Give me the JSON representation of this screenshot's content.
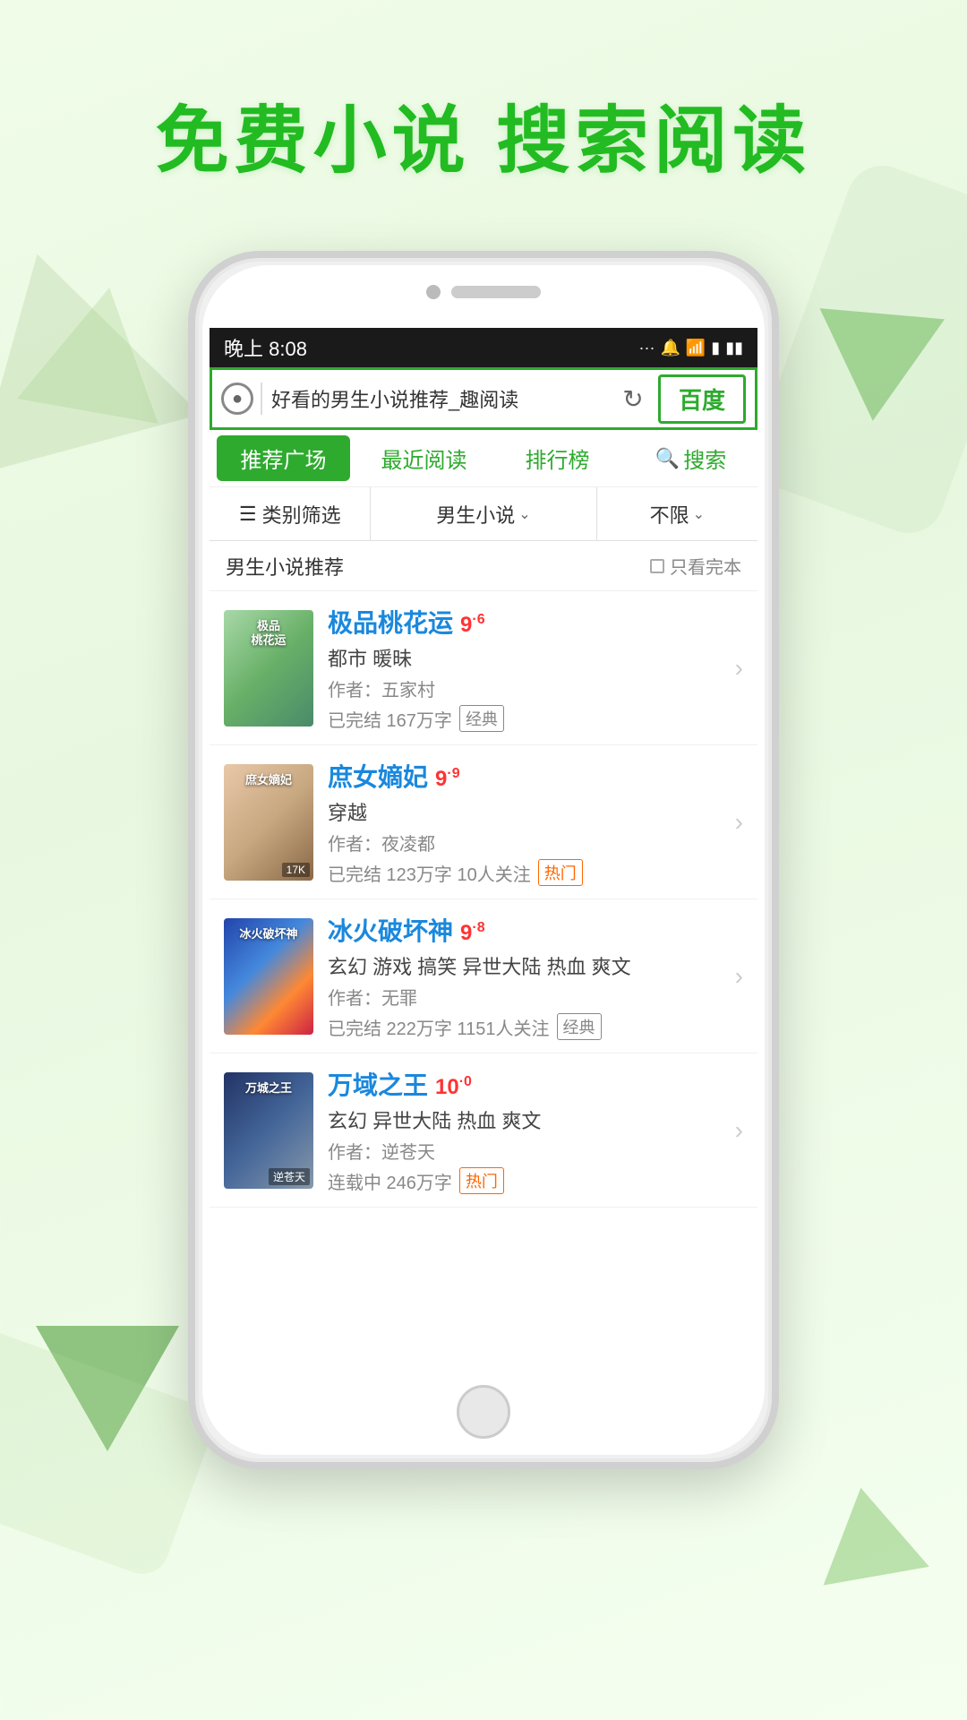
{
  "page": {
    "background_color": "#eefae6",
    "header_title": "免费小说  搜索阅读"
  },
  "status_bar": {
    "time": "晚上 8:08",
    "icons": "... 🔔 WiFi 📷 ⚡ 🔋"
  },
  "search_bar": {
    "query": "好看的男生小说推荐_趣阅读",
    "baidu_label": "百度"
  },
  "tabs": [
    {
      "id": "recommend",
      "label": "推荐广场",
      "active": true
    },
    {
      "id": "recent",
      "label": "最近阅读",
      "active": false
    },
    {
      "id": "ranking",
      "label": "排行榜",
      "active": false
    },
    {
      "id": "search",
      "label": "搜索",
      "active": false
    }
  ],
  "filters": {
    "category_label": "类别筛选",
    "gender_label": "男生小说",
    "limit_label": "不限"
  },
  "section": {
    "title": "男生小说推荐",
    "filter_label": "只看完本"
  },
  "books": [
    {
      "id": "1",
      "title": "极品桃花运",
      "rating": "9",
      "rating_decimal": "6",
      "genre": "都市 暖昧",
      "author": "作者：五家村",
      "meta": "已完结 167万字",
      "tag": "经典",
      "tag_type": "classic",
      "cover_text": "极品\n桃花运",
      "cover_type": "1"
    },
    {
      "id": "2",
      "title": "庶女嫡妃",
      "rating": "9",
      "rating_decimal": "9",
      "genre": "穿越",
      "author": "作者：夜凌都",
      "meta": "已完结 123万字 10人关注",
      "tag": "热门",
      "tag_type": "hot",
      "cover_text": "庶女嫡妃",
      "cover_badge": "17K",
      "cover_type": "2"
    },
    {
      "id": "3",
      "title": "冰火破坏神",
      "rating": "9",
      "rating_decimal": "8",
      "genre": "玄幻 游戏 搞笑 异世大陆 热血 爽文",
      "author": "作者：无罪",
      "meta": "已完结 222万字 1151人关注",
      "tag": "经典",
      "tag_type": "classic",
      "cover_text": "冰火破坏神",
      "cover_type": "3"
    },
    {
      "id": "4",
      "title": "万域之王",
      "rating": "10",
      "rating_decimal": "0",
      "genre": "玄幻 异世大陆 热血 爽文",
      "author": "作者：逆苍天",
      "meta": "连载中 246万字",
      "tag": "热门",
      "tag_type": "hot",
      "cover_text": "万城之王",
      "cover_badge": "逆苍天",
      "cover_type": "4"
    }
  ]
}
